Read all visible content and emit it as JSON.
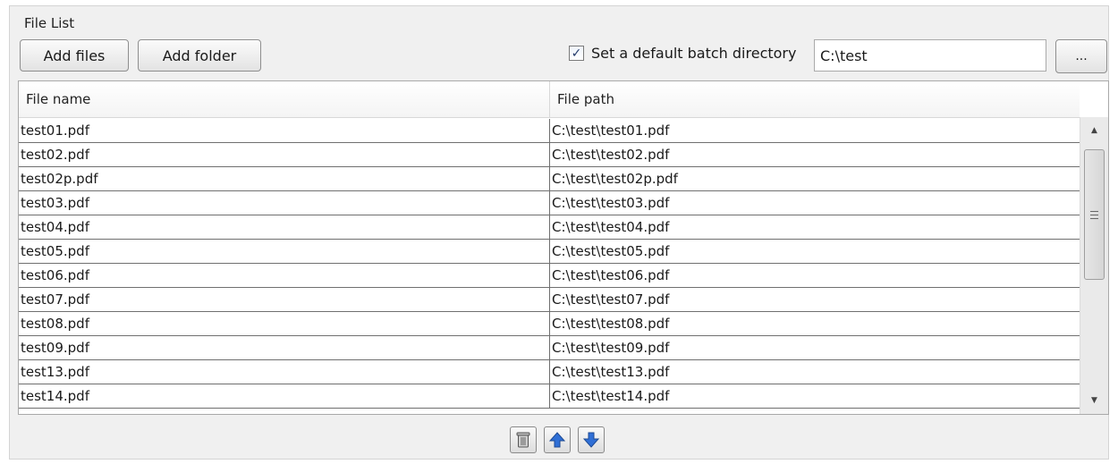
{
  "group": {
    "title": "File List"
  },
  "toolbar": {
    "add_files_label": "Add files",
    "add_folder_label": "Add folder",
    "default_dir_checked": true,
    "default_dir_label": "Set a default batch directory",
    "default_dir_value": "C:\\test",
    "browse_label": "..."
  },
  "table": {
    "columns": [
      "File name",
      "File path"
    ],
    "rows": [
      {
        "name": "test01.pdf",
        "path": "C:\\test\\test01.pdf"
      },
      {
        "name": "test02.pdf",
        "path": "C:\\test\\test02.pdf"
      },
      {
        "name": "test02p.pdf",
        "path": "C:\\test\\test02p.pdf"
      },
      {
        "name": "test03.pdf",
        "path": "C:\\test\\test03.pdf"
      },
      {
        "name": "test04.pdf",
        "path": "C:\\test\\test04.pdf"
      },
      {
        "name": "test05.pdf",
        "path": "C:\\test\\test05.pdf"
      },
      {
        "name": "test06.pdf",
        "path": "C:\\test\\test06.pdf"
      },
      {
        "name": "test07.pdf",
        "path": "C:\\test\\test07.pdf"
      },
      {
        "name": "test08.pdf",
        "path": "C:\\test\\test08.pdf"
      },
      {
        "name": "test09.pdf",
        "path": "C:\\test\\test09.pdf"
      },
      {
        "name": "test13.pdf",
        "path": "C:\\test\\test13.pdf"
      },
      {
        "name": "test14.pdf",
        "path": "C:\\test\\test14.pdf"
      }
    ]
  },
  "bottom_tools": {
    "icons": [
      "trash-icon",
      "arrow-up-icon",
      "arrow-down-icon"
    ]
  },
  "colors": {
    "accent": "#2f6fd6",
    "border": "#6f6f6f"
  }
}
